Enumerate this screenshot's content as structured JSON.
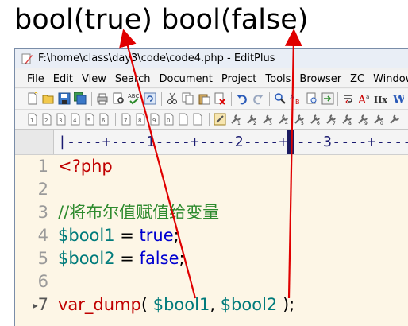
{
  "caption": {
    "text1": "bool(true)",
    "text2": "bool(false)"
  },
  "window": {
    "title": "F:\\home\\class\\day3\\code\\code4.php - EditPlus"
  },
  "menu": {
    "items": [
      "File",
      "Edit",
      "View",
      "Search",
      "Document",
      "Project",
      "Tools",
      "Browser",
      "ZC",
      "Window"
    ]
  },
  "toolbar1": {
    "icons": [
      "new-file-icon",
      "open-folder-icon",
      "save-icon",
      "save-all-icon",
      "print-icon",
      "print-preview-icon",
      "spell-check-icon",
      "refresh-icon",
      "cut-icon",
      "copy-icon",
      "paste-icon",
      "delete-icon",
      "undo-icon",
      "redo-icon",
      "find-icon",
      "replace-icon",
      "find-in-files-icon",
      "goto-line-icon",
      "word-wrap-icon",
      "font-size-icon",
      "hex-icon",
      "case-icon"
    ]
  },
  "toolbar2": {
    "icons": [
      "document-1-icon",
      "document-2-icon",
      "document-3-icon",
      "document-4-icon",
      "document-5-icon",
      "document-6-icon",
      "document-7-icon",
      "document-8-icon",
      "document-9-icon",
      "document-0-icon",
      "tool-settings-icon",
      "user-tool-1-icon",
      "user-tool-2-icon",
      "user-tool-3-icon",
      "user-tool-4-icon",
      "user-tool-5-icon",
      "user-tool-6-icon",
      "user-tool-7-icon",
      "user-tool-8-icon",
      "user-tool-9-icon",
      "user-tool-0-icon"
    ]
  },
  "ruler": {
    "text": "|----+----1----+----2----+----3----+----"
  },
  "editor": {
    "line_numbers": [
      "1",
      "2",
      "3",
      "4",
      "5",
      "6",
      "7"
    ],
    "marked_line": "7",
    "lines": {
      "l1": "<?php",
      "l3": "//将布尔值赋值给变量",
      "l4_var": "$bool1",
      "l4_eq": " = ",
      "l4_val": "true",
      "l4_end": ";",
      "l5_var": "$bool2",
      "l5_eq": " = ",
      "l5_val": "false",
      "l5_end": ";",
      "l7_fn": "var_dump",
      "l7_open": "( ",
      "l7_a": "$bool1",
      "l7_comma": ", ",
      "l7_b": "$bool2",
      "l7_close": " );"
    }
  },
  "colors": {
    "keyword_red": "#c00000",
    "comment_green": "#2e8b2e",
    "variable_teal": "#007b7b",
    "constant_blue": "#0000d0",
    "arrow_red": "#e00000",
    "editor_bg": "#fdf6e6"
  }
}
